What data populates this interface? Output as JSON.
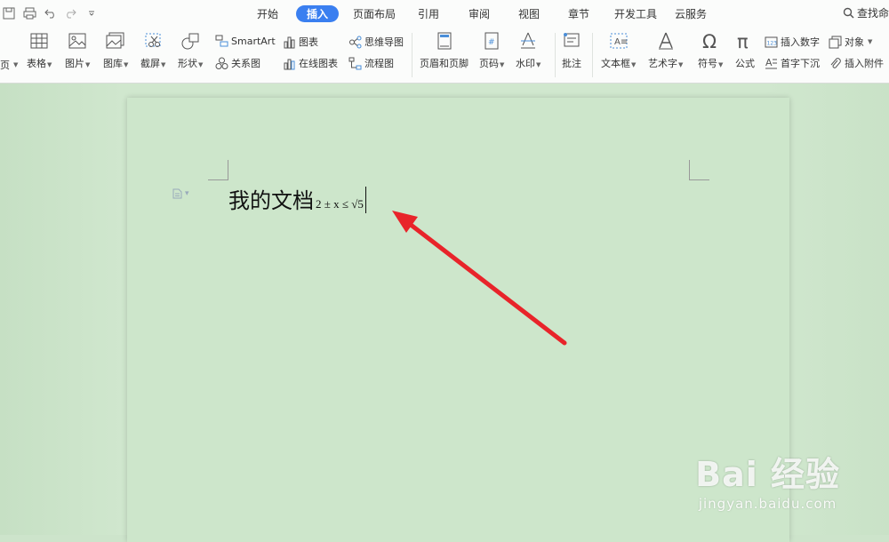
{
  "menu": {
    "tabs": [
      "开始",
      "插入",
      "页面布局",
      "引用",
      "审阅",
      "视图",
      "章节",
      "开发工具",
      "云服务"
    ],
    "active_tab": "插入",
    "find_label": "查找命"
  },
  "ribbon": {
    "left_cut": "页",
    "table": "表格",
    "picture": "图片",
    "gallery": "图库",
    "screenshot": "截屏",
    "shape": "形状",
    "smartart": "SmartArt",
    "relation": "关系图",
    "chart": "图表",
    "online_chart": "在线图表",
    "mindmap": "思维导图",
    "flowchart": "流程图",
    "header_footer": "页眉和页脚",
    "page_number": "页码",
    "watermark": "水印",
    "comment": "批注",
    "textbox": "文本框",
    "wordart": "艺术字",
    "symbol": "符号",
    "formula": "公式",
    "insert_number": "插入数字",
    "drop_cap": "首字下沉",
    "object": "对象",
    "attachment": "插入附件"
  },
  "document": {
    "text": "我的文档",
    "formula": "2 ± x ≤ √5"
  },
  "watermark": {
    "logo": "Bai 经验",
    "url": "jingyan.baidu.com"
  },
  "colors": {
    "accent": "#3a7ff0",
    "page": "#cde6cb",
    "arrow": "#e8242a"
  }
}
